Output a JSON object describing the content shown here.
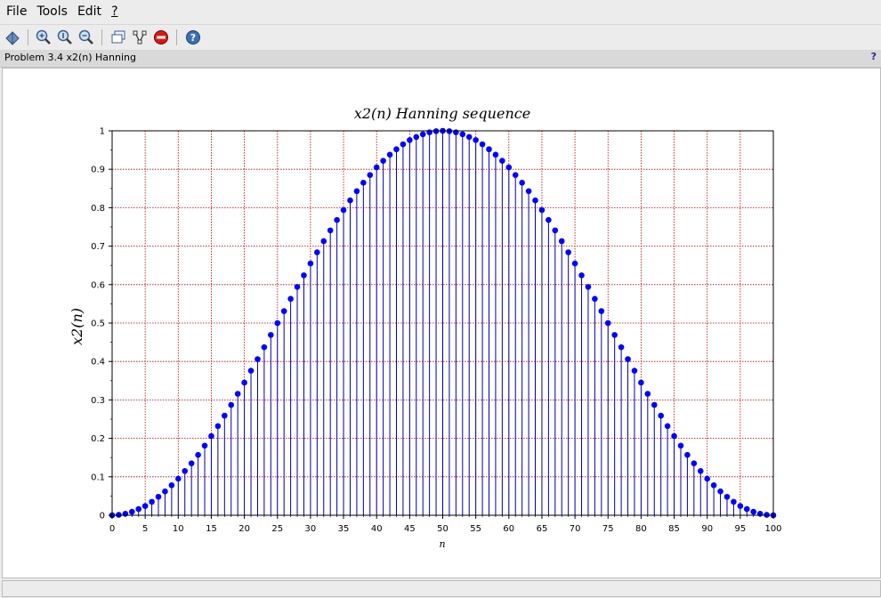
{
  "menu": {
    "file": "File",
    "tools": "Tools",
    "edit": "Edit",
    "help": "?"
  },
  "toolbar": {
    "icons": [
      "rotate-icon",
      "zoom-in-icon",
      "zoom-original-icon",
      "zoom-out-icon",
      "datatip-icon",
      "graph-icon",
      "stop-icon",
      "help-icon"
    ]
  },
  "infobar": {
    "title": "Problem 3.4 x2(n) Hanning",
    "help": "?"
  },
  "colors": {
    "stem": "#0000aa",
    "marker": "#0000ff",
    "grid": "#b00000"
  },
  "chart_data": {
    "type": "scatter",
    "subtype": "stem",
    "title": "x2(n) Hanning sequence",
    "xlabel": "n",
    "ylabel": "x2(n)",
    "xlim": [
      0,
      100
    ],
    "ylim": [
      0,
      1
    ],
    "xticks": [
      "0",
      "5",
      "10",
      "15",
      "20",
      "25",
      "30",
      "35",
      "40",
      "45",
      "50",
      "55",
      "60",
      "65",
      "70",
      "75",
      "80",
      "85",
      "90",
      "95",
      "100"
    ],
    "yticks": [
      "0",
      "0.1",
      "0.2",
      "0.3",
      "0.4",
      "0.5",
      "0.6",
      "0.7",
      "0.8",
      "0.9",
      "1"
    ],
    "grid": true,
    "x": [
      0,
      1,
      2,
      3,
      4,
      5,
      6,
      7,
      8,
      9,
      10,
      11,
      12,
      13,
      14,
      15,
      16,
      17,
      18,
      19,
      20,
      21,
      22,
      23,
      24,
      25,
      26,
      27,
      28,
      29,
      30,
      31,
      32,
      33,
      34,
      35,
      36,
      37,
      38,
      39,
      40,
      41,
      42,
      43,
      44,
      45,
      46,
      47,
      48,
      49,
      50,
      51,
      52,
      53,
      54,
      55,
      56,
      57,
      58,
      59,
      60,
      61,
      62,
      63,
      64,
      65,
      66,
      67,
      68,
      69,
      70,
      71,
      72,
      73,
      74,
      75,
      76,
      77,
      78,
      79,
      80,
      81,
      82,
      83,
      84,
      85,
      86,
      87,
      88,
      89,
      90,
      91,
      92,
      93,
      94,
      95,
      96,
      97,
      98,
      99,
      100
    ],
    "values": [
      0,
      0.001,
      0.004,
      0.009,
      0.016,
      0.024,
      0.035,
      0.048,
      0.062,
      0.078,
      0.095,
      0.115,
      0.135,
      0.157,
      0.181,
      0.206,
      0.232,
      0.259,
      0.287,
      0.316,
      0.345,
      0.376,
      0.406,
      0.437,
      0.469,
      0.5,
      0.531,
      0.563,
      0.594,
      0.624,
      0.655,
      0.684,
      0.713,
      0.741,
      0.768,
      0.794,
      0.819,
      0.843,
      0.865,
      0.885,
      0.905,
      0.922,
      0.938,
      0.952,
      0.965,
      0.976,
      0.984,
      0.991,
      0.996,
      0.999,
      1,
      0.999,
      0.996,
      0.991,
      0.984,
      0.976,
      0.965,
      0.952,
      0.938,
      0.922,
      0.905,
      0.885,
      0.865,
      0.843,
      0.819,
      0.794,
      0.768,
      0.741,
      0.713,
      0.684,
      0.655,
      0.624,
      0.594,
      0.563,
      0.531,
      0.5,
      0.469,
      0.437,
      0.406,
      0.376,
      0.345,
      0.316,
      0.287,
      0.259,
      0.232,
      0.206,
      0.181,
      0.157,
      0.135,
      0.115,
      0.095,
      0.078,
      0.062,
      0.048,
      0.035,
      0.024,
      0.016,
      0.009,
      0.004,
      0.001,
      0
    ]
  }
}
